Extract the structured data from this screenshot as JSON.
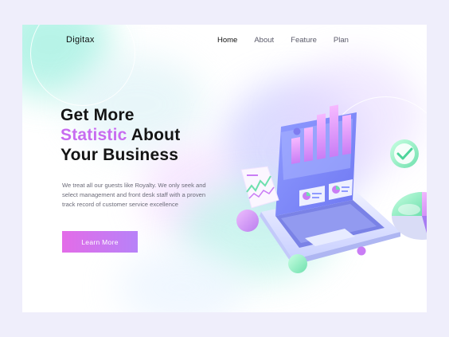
{
  "brand": "Digitax",
  "nav": {
    "items": [
      {
        "label": "Home",
        "active": true
      },
      {
        "label": "About",
        "active": false
      },
      {
        "label": "Feature",
        "active": false
      },
      {
        "label": "Plan",
        "active": false
      }
    ]
  },
  "hero": {
    "line1": "Get More",
    "line2_highlight": "Statistic",
    "line2_rest": " About",
    "line3": "Your Business",
    "description": "We treat all our guests like Royalty.  We only seek and select management and front desk staff with a proven track record of customer service excellence",
    "cta_label": "Learn More"
  },
  "colors": {
    "accent": "#c86cf0",
    "button_start": "#e36ce8",
    "button_end": "#b782f8",
    "page_bg": "#efeefb",
    "headline": "#141414"
  },
  "icons": [
    "checkmark-icon",
    "bar-chart-icon",
    "pie-chart-icon",
    "laptop-icon",
    "line-chart-card-icon"
  ]
}
